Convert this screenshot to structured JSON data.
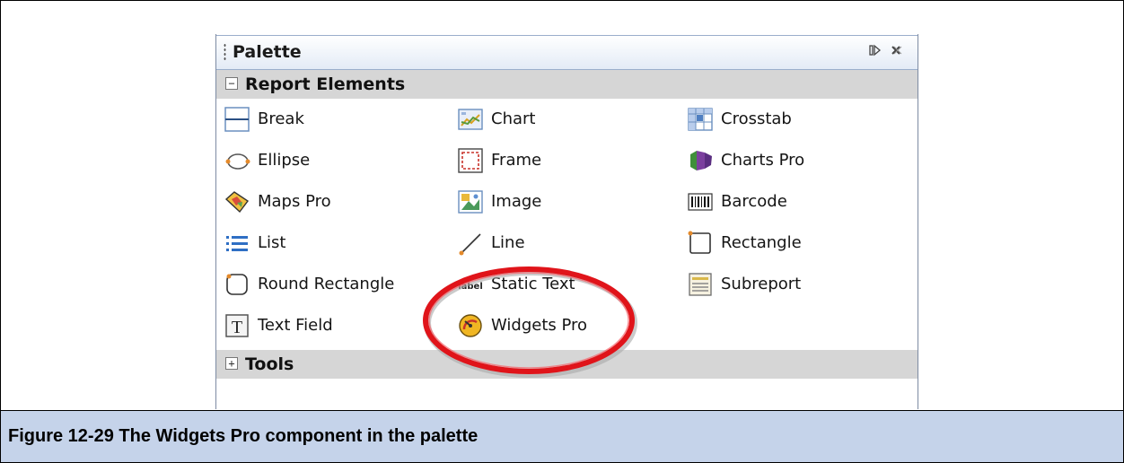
{
  "palette": {
    "title": "Palette",
    "sections": [
      {
        "label": "Report Elements",
        "expanded": true,
        "toggle": "−"
      },
      {
        "label": "Tools",
        "expanded": false,
        "toggle": "+"
      }
    ],
    "columns": [
      [
        {
          "label": "Break",
          "icon": "break-icon"
        },
        {
          "label": "Ellipse",
          "icon": "ellipse-icon"
        },
        {
          "label": "Maps Pro",
          "icon": "maps-pro-icon"
        },
        {
          "label": "List",
          "icon": "list-icon"
        },
        {
          "label": "Round Rectangle",
          "icon": "round-rectangle-icon"
        },
        {
          "label": "Text Field",
          "icon": "text-field-icon"
        }
      ],
      [
        {
          "label": "Chart",
          "icon": "chart-icon"
        },
        {
          "label": "Frame",
          "icon": "frame-icon"
        },
        {
          "label": "Image",
          "icon": "image-icon"
        },
        {
          "label": "Line",
          "icon": "line-icon"
        },
        {
          "label": "Static Text",
          "icon": "static-text-icon",
          "icon_text": "label"
        },
        {
          "label": "Widgets Pro",
          "icon": "widgets-pro-icon"
        }
      ],
      [
        {
          "label": "Crosstab",
          "icon": "crosstab-icon"
        },
        {
          "label": "Charts Pro",
          "icon": "charts-pro-icon"
        },
        {
          "label": "Barcode",
          "icon": "barcode-icon"
        },
        {
          "label": "Rectangle",
          "icon": "rectangle-icon"
        },
        {
          "label": "Subreport",
          "icon": "subreport-icon"
        }
      ]
    ]
  },
  "caption": "Figure 12-29  The Widgets Pro component in the palette",
  "colors": {
    "caption_bg": "#c5d3ea",
    "highlight_ring": "#e0141a",
    "section_bg": "#d6d6d6"
  }
}
